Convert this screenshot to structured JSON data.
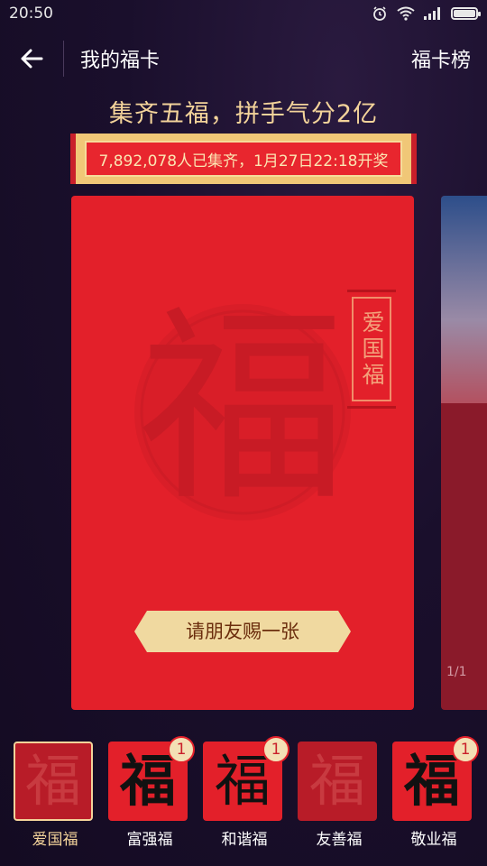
{
  "status_bar": {
    "time": "20:50"
  },
  "header": {
    "title": "我的福卡",
    "rank_link": "福卡榜"
  },
  "slogan": "集齐五福，拼手气分2亿",
  "banner": "7,892,078人已集齐，1月27日22:18开奖",
  "card": {
    "emblem_glyph": "福",
    "label": "爱国福",
    "request_button": "请朋友赐一张"
  },
  "next_card": {
    "counter": "1/1"
  },
  "tray": [
    {
      "label": "爱国福",
      "glyph": "福",
      "count": ""
    },
    {
      "label": "富强福",
      "glyph": "福",
      "count": "1"
    },
    {
      "label": "和谐福",
      "glyph": "福",
      "count": "1"
    },
    {
      "label": "友善福",
      "glyph": "福",
      "count": ""
    },
    {
      "label": "敬业福",
      "glyph": "福",
      "count": "1"
    }
  ]
}
